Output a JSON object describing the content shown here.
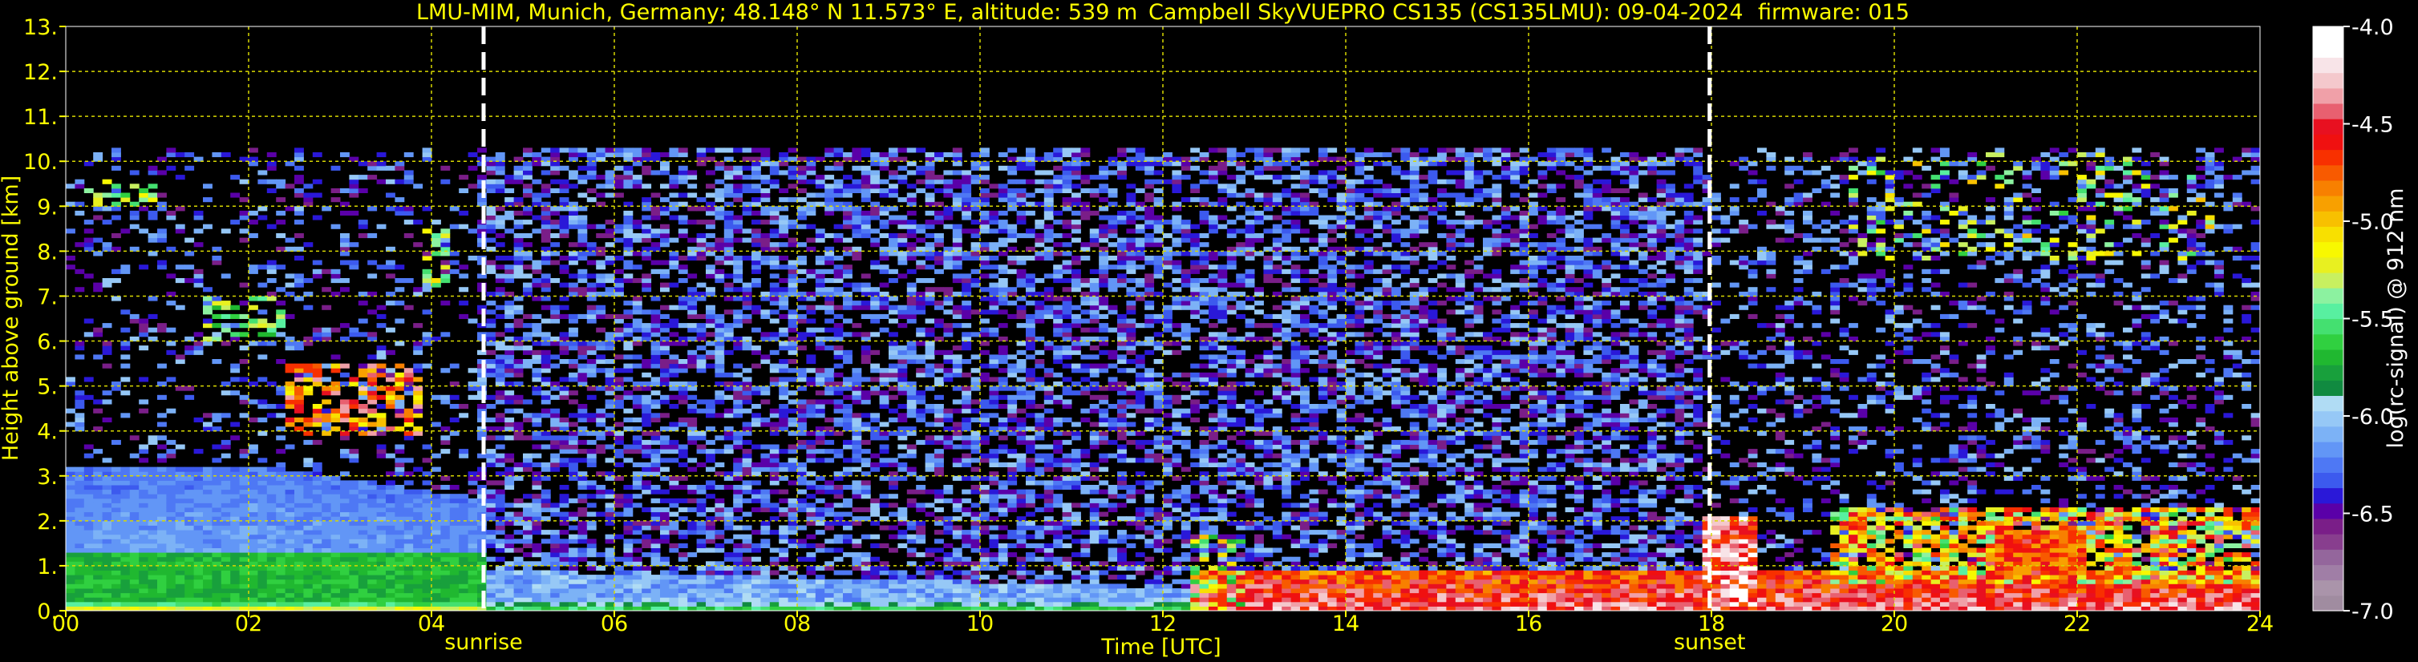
{
  "title": {
    "location": "LMU-MIM, Munich, Germany; 48.148° N 11.573° E, altitude: 539 m",
    "instrument": "Campbell SkyVUEPRO CS135 (CS135LMU): 09-04-2024",
    "firmware": "firmware: 015"
  },
  "colors": {
    "text": "#ffff00",
    "grid": "#d8d800",
    "background": "#000000",
    "marker_line": "#ffffff"
  },
  "chart_data": {
    "type": "heatmap",
    "xlabel": "Time [UTC]",
    "ylabel": "Height above ground [km]",
    "xlim": [
      0,
      24
    ],
    "ylim": [
      0,
      13
    ],
    "x_ticks": [
      {
        "value": 0,
        "label": "00"
      },
      {
        "value": 2,
        "label": "02"
      },
      {
        "value": 4,
        "label": "04"
      },
      {
        "value": 6,
        "label": "06"
      },
      {
        "value": 8,
        "label": "08"
      },
      {
        "value": 10,
        "label": "10"
      },
      {
        "value": 12,
        "label": "12"
      },
      {
        "value": 14,
        "label": "14"
      },
      {
        "value": 16,
        "label": "16"
      },
      {
        "value": 18,
        "label": "18"
      },
      {
        "value": 20,
        "label": "20"
      },
      {
        "value": 22,
        "label": "22"
      },
      {
        "value": 24,
        "label": "24"
      }
    ],
    "y_ticks": [
      {
        "value": 0,
        "label": "0."
      },
      {
        "value": 1,
        "label": "1."
      },
      {
        "value": 2,
        "label": "2."
      },
      {
        "value": 3,
        "label": "3."
      },
      {
        "value": 4,
        "label": "4."
      },
      {
        "value": 5,
        "label": "5."
      },
      {
        "value": 6,
        "label": "6."
      },
      {
        "value": 7,
        "label": "7."
      },
      {
        "value": 8,
        "label": "8."
      },
      {
        "value": 9,
        "label": "9."
      },
      {
        "value": 10,
        "label": "10."
      },
      {
        "value": 11,
        "label": "11."
      },
      {
        "value": 12,
        "label": "12."
      },
      {
        "value": 13,
        "label": "13."
      }
    ],
    "grid": true,
    "markers": [
      {
        "label": "sunrise",
        "x": 4.57
      },
      {
        "label": "sunset",
        "x": 17.98
      }
    ],
    "colorbar": {
      "label": "log(rc-signal) @ 912 nm",
      "range": [
        -7.0,
        -4.0
      ],
      "ticks": [
        {
          "value": -4.0,
          "label": "-4.0"
        },
        {
          "value": -4.5,
          "label": "-4.5"
        },
        {
          "value": -5.0,
          "label": "-5.0"
        },
        {
          "value": -5.5,
          "label": "-5.5"
        },
        {
          "value": -6.0,
          "label": "-6.0"
        },
        {
          "value": -6.5,
          "label": "-6.5"
        },
        {
          "value": -7.0,
          "label": "-7.0"
        }
      ],
      "colors": [
        "#a08ca0",
        "#aa94aa",
        "#a07ea6",
        "#94669c",
        "#883e8e",
        "#7a1e88",
        "#5a00a8",
        "#2a18d8",
        "#3c5aee",
        "#4e78f4",
        "#6296f6",
        "#7cb2f6",
        "#96c8f6",
        "#b0dcf4",
        "#108a40",
        "#18a03c",
        "#20b830",
        "#30d040",
        "#44e070",
        "#58f0a0",
        "#8cf2a0",
        "#c8f060",
        "#e8f020",
        "#f8f800",
        "#f8e000",
        "#f8c000",
        "#f8a000",
        "#f88000",
        "#f85a00",
        "#f83000",
        "#f01010",
        "#e81020",
        "#e86070",
        "#f0a0a8",
        "#f4c8cc",
        "#f8e4e8",
        "#ffffff",
        "#ffffff"
      ]
    },
    "features": [
      {
        "name": "residual layer / aerosol",
        "x": [
          0,
          4.6
        ],
        "y": [
          0,
          3.2
        ],
        "level": -6.0
      },
      {
        "name": "noise region",
        "x": [
          0,
          24
        ],
        "y": [
          0,
          10.2
        ],
        "level": -6.5
      },
      {
        "name": "mid-level cloud",
        "x": [
          2.4,
          3.9
        ],
        "y": [
          3.8,
          5.5
        ],
        "level": -4.8
      },
      {
        "name": "afternoon boundary layer",
        "x": [
          12.3,
          24
        ],
        "y": [
          0,
          1.0
        ],
        "level": -4.2
      },
      {
        "name": "evening convective layer",
        "x": [
          19.3,
          24
        ],
        "y": [
          0.5,
          2.3
        ],
        "level": -4.6
      }
    ]
  }
}
